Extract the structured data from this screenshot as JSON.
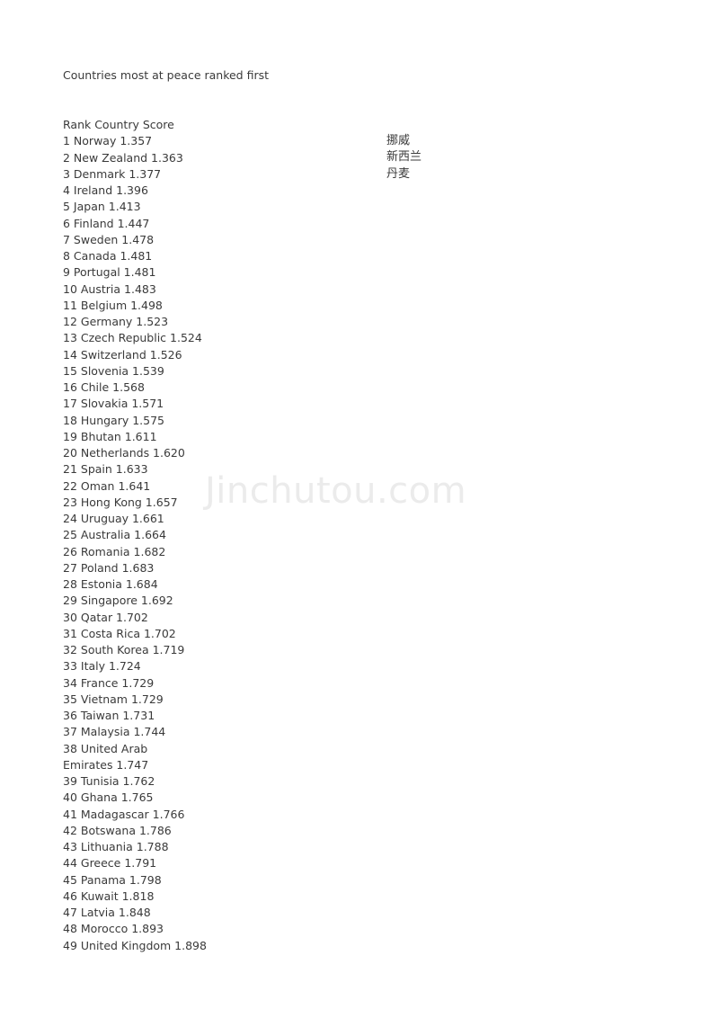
{
  "document": {
    "title": "Countries most at peace ranked first",
    "watermark": "Jinchutou.com",
    "watermark_color": "#ebebeb",
    "text_color": "#3a3a3a",
    "background_color": "#ffffff"
  },
  "list_header": "Rank Country Score",
  "rows": [
    {
      "line": "1 Norway 1.357"
    },
    {
      "line": "2 New Zealand 1.363"
    },
    {
      "line": "3 Denmark 1.377"
    },
    {
      "line": "4 Ireland 1.396"
    },
    {
      "line": "5 Japan 1.413"
    },
    {
      "line": "6 Finland 1.447"
    },
    {
      "line": "7 Sweden 1.478"
    },
    {
      "line": "8 Canada 1.481"
    },
    {
      "line": "9 Portugal 1.481"
    },
    {
      "line": "10 Austria 1.483"
    },
    {
      "line": "11 Belgium 1.498"
    },
    {
      "line": "12 Germany 1.523"
    },
    {
      "line": "13 Czech Republic 1.524"
    },
    {
      "line": "14 Switzerland 1.526"
    },
    {
      "line": "15 Slovenia 1.539"
    },
    {
      "line": "16 Chile 1.568"
    },
    {
      "line": "17 Slovakia 1.571"
    },
    {
      "line": "18 Hungary 1.575"
    },
    {
      "line": "19 Bhutan 1.611"
    },
    {
      "line": "20 Netherlands 1.620"
    },
    {
      "line": "21 Spain 1.633"
    },
    {
      "line": "22 Oman 1.641"
    },
    {
      "line": "23 Hong Kong 1.657"
    },
    {
      "line": "24 Uruguay 1.661"
    },
    {
      "line": "25 Australia 1.664"
    },
    {
      "line": "26 Romania 1.682"
    },
    {
      "line": "27 Poland 1.683"
    },
    {
      "line": "28 Estonia 1.684"
    },
    {
      "line": "29 Singapore 1.692"
    },
    {
      "line": "30 Qatar 1.702"
    },
    {
      "line": "31 Costa Rica 1.702"
    },
    {
      "line": "32 South Korea 1.719"
    },
    {
      "line": "33 Italy 1.724"
    },
    {
      "line": "34 France 1.729"
    },
    {
      "line": "35 Vietnam 1.729"
    },
    {
      "line": "36 Taiwan 1.731"
    },
    {
      "line": "37 Malaysia 1.744"
    },
    {
      "line": "38 United Arab"
    },
    {
      "line": "Emirates 1.747"
    },
    {
      "line": "39 Tunisia 1.762"
    },
    {
      "line": "40 Ghana 1.765"
    },
    {
      "line": "41 Madagascar 1.766"
    },
    {
      "line": "42 Botswana 1.786"
    },
    {
      "line": "43 Lithuania 1.788"
    },
    {
      "line": "44 Greece 1.791"
    },
    {
      "line": "45 Panama 1.798"
    },
    {
      "line": "46 Kuwait 1.818"
    },
    {
      "line": "47 Latvia 1.848"
    },
    {
      "line": "48 Morocco 1.893"
    },
    {
      "line": "49 United Kingdom 1.898"
    }
  ],
  "annotations_cn": [
    {
      "text": "挪威"
    },
    {
      "text": "新西兰"
    },
    {
      "text": "丹麦"
    }
  ]
}
